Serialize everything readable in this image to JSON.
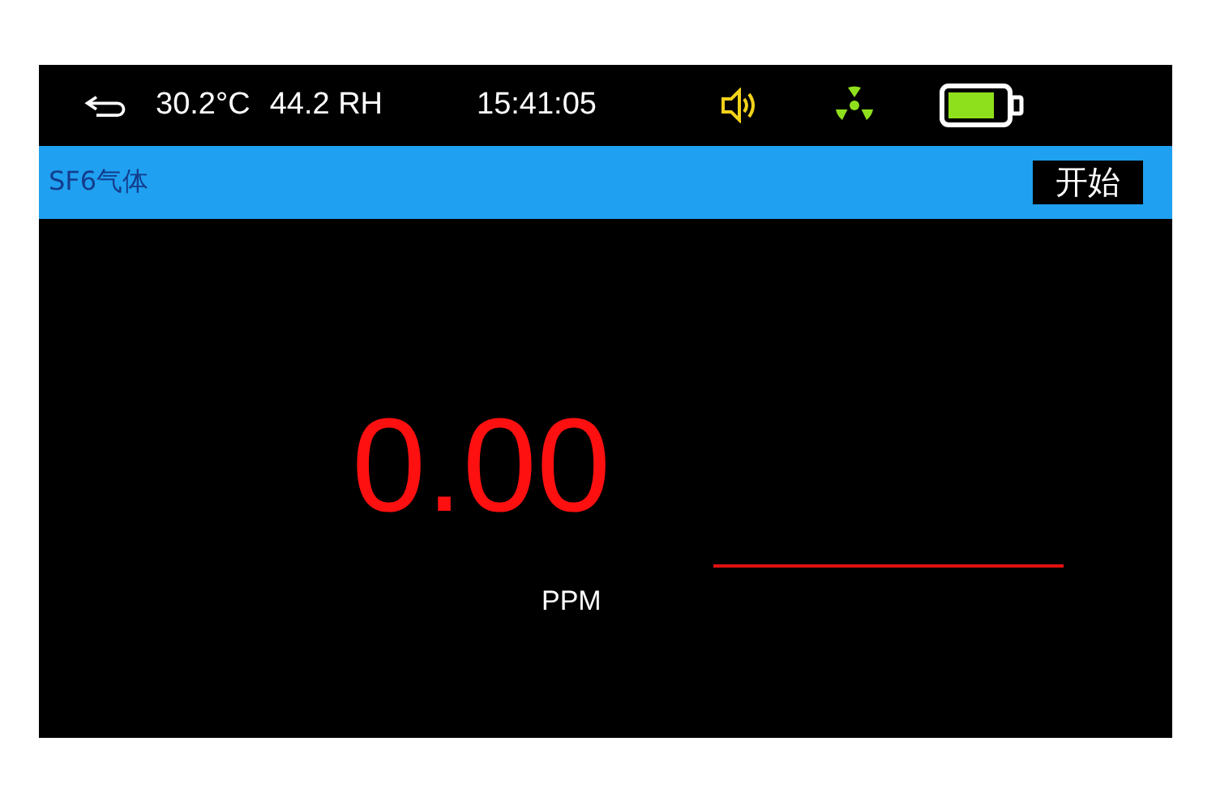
{
  "status_bar": {
    "temperature": "30.2°C",
    "humidity": "44.2 RH",
    "time": "15:41:05"
  },
  "header": {
    "title": "SF6气体",
    "start_button": "开始"
  },
  "reading": {
    "value": "0.00",
    "unit": "PPM"
  }
}
